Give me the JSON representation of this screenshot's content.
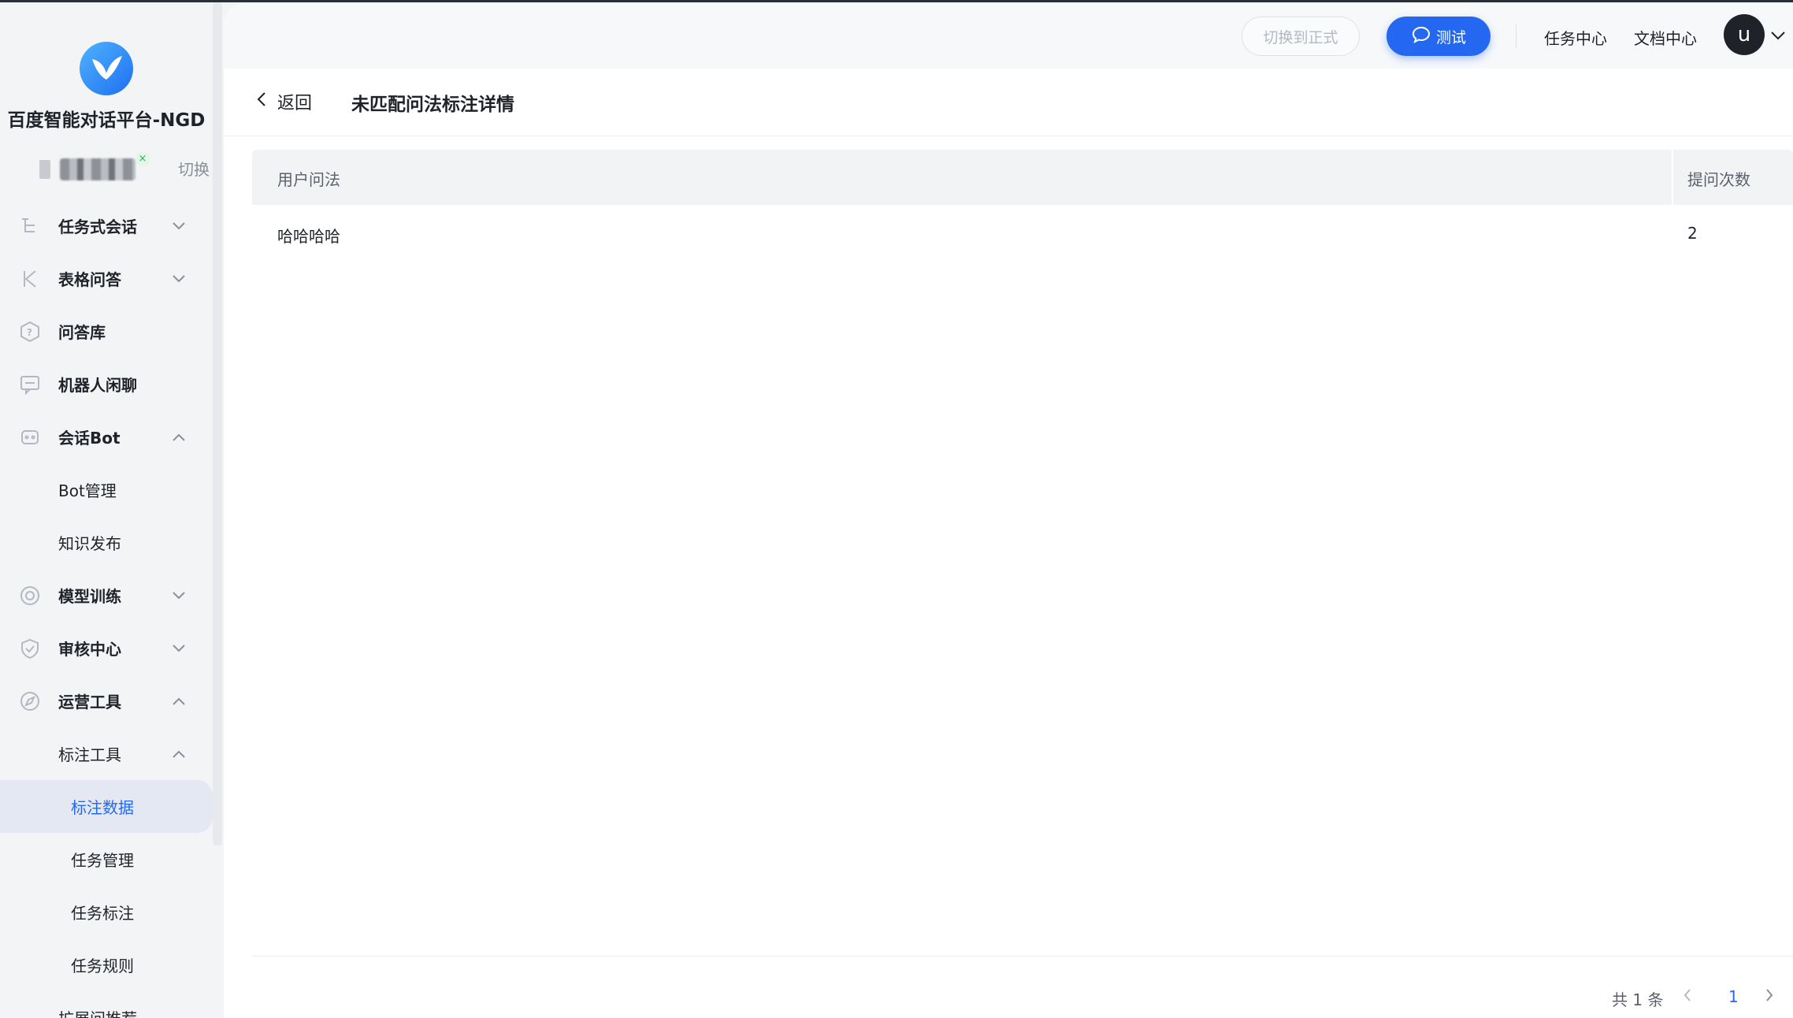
{
  "app": {
    "name": "百度智能对话平台-NGD",
    "switch_label": "切换"
  },
  "sidebar": {
    "items": [
      {
        "label": "任务式会话",
        "icon": "tree-icon",
        "expanded": false
      },
      {
        "label": "表格问答",
        "icon": "k-icon",
        "expanded": false
      },
      {
        "label": "问答库",
        "icon": "question-icon"
      },
      {
        "label": "机器人闲聊",
        "icon": "chat-icon"
      },
      {
        "label": "会话Bot",
        "icon": "robot-icon",
        "expanded": true
      },
      {
        "label": "Bot管理"
      },
      {
        "label": "知识发布"
      },
      {
        "label": "模型训练",
        "icon": "target-icon",
        "expanded": false
      },
      {
        "label": "审核中心",
        "icon": "shield-icon",
        "expanded": false
      },
      {
        "label": "运营工具",
        "icon": "compass-icon",
        "expanded": true
      },
      {
        "label": "标注工具",
        "expanded": true
      },
      {
        "label": "标注数据",
        "active": true
      },
      {
        "label": "任务管理"
      },
      {
        "label": "任务标注"
      },
      {
        "label": "任务规则"
      },
      {
        "label": "扩展问推荐"
      }
    ]
  },
  "header": {
    "switch_env": "切换到正式",
    "test": "测试",
    "task_center": "任务中心",
    "doc_center": "文档中心",
    "avatar_letter": "u"
  },
  "page": {
    "back": "返回",
    "title": "未匹配问法标注详情"
  },
  "table": {
    "columns": [
      "用户问法",
      "提问次数"
    ],
    "rows": [
      [
        "哈哈哈哈",
        "2"
      ]
    ]
  },
  "pagination": {
    "total": "共 1 条",
    "current": "1"
  },
  "colors": {
    "primary": "#2468f2",
    "sidebar_bg": "#f3f4f6",
    "active_bg": "#e3e8f2"
  }
}
